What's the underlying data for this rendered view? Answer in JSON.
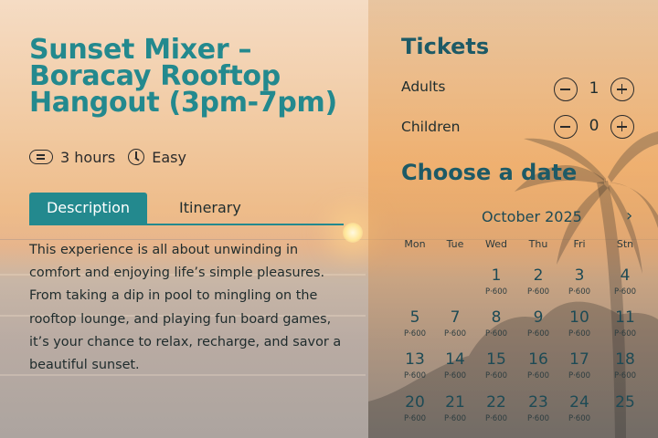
{
  "experience": {
    "title": "Sunset Mixer – Boracay Rooftop Hangout (3pm-7pm)",
    "duration": "3 hours",
    "difficulty": "Easy",
    "tabs": [
      "Description",
      "Itinerary"
    ],
    "description": "This experience is all about unwinding in comfort and enjoying life’s simple pleasures. From taking a dip in pool to mingling on the rooftop lounge, and playing fun board games, it’s your chance to relax, recharge, and savor a beautiful sunset."
  },
  "tickets": {
    "heading": "Tickets",
    "adults": {
      "label": "Adults",
      "value": "1"
    },
    "children": {
      "label": "Children",
      "value": "0"
    }
  },
  "calendar": {
    "heading": "Choose a date",
    "month": "October 2025",
    "next_icon": "chevron-right-icon",
    "weekdays": [
      "Mon",
      "Tue",
      "Wed",
      "Thu",
      "Fri",
      "Stn"
    ],
    "weeks": [
      [
        null,
        null,
        {
          "day": "1",
          "price": "P·600"
        },
        {
          "day": "2",
          "price": "P·600"
        },
        {
          "day": "3",
          "price": "P·600"
        },
        {
          "day": "4",
          "price": "P·600"
        }
      ],
      [
        {
          "day": "5",
          "price": "P·600"
        },
        {
          "day": "7",
          "price": "P·600"
        },
        {
          "day": "8",
          "price": "P·600"
        },
        {
          "day": "9",
          "price": "P·600"
        },
        {
          "day": "10",
          "price": "P·600"
        },
        {
          "day": "11",
          "price": "P·600"
        }
      ],
      [
        {
          "day": "13",
          "price": "P·600"
        },
        {
          "day": "14",
          "price": "P·600"
        },
        {
          "day": "15",
          "price": "P·600"
        },
        {
          "day": "16",
          "price": "P·600"
        },
        {
          "day": "17",
          "price": "P·600"
        },
        {
          "day": "18",
          "price": "P·600"
        }
      ],
      [
        {
          "day": "20",
          "price": "P·600"
        },
        {
          "day": "21",
          "price": "P·600"
        },
        {
          "day": "22",
          "price": "P·600"
        },
        {
          "day": "23",
          "price": "P·600"
        },
        {
          "day": "24",
          "price": "P·600"
        },
        {
          "day": "25",
          "price": ""
        }
      ]
    ]
  },
  "colors": {
    "accent": "#23898e",
    "heading_dark": "#1d5a66"
  }
}
